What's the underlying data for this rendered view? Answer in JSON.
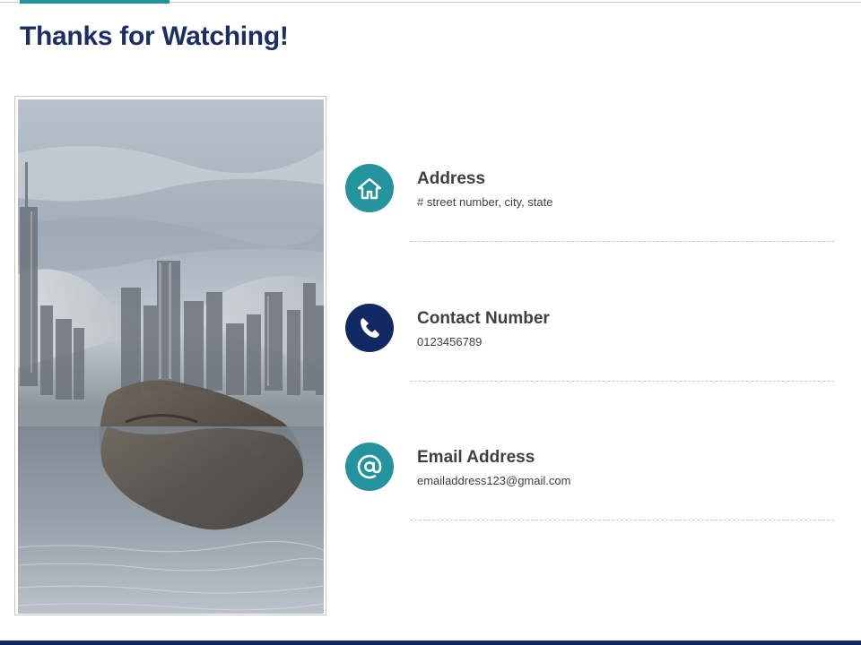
{
  "slide": {
    "title": "Thanks for Watching!"
  },
  "colors": {
    "title": "#1c2f63",
    "teal_accent": "#24939e",
    "navy_accent": "#122a63",
    "bottom_bar": "#122a63"
  },
  "photo": {
    "description_icon": "handshake-over-city-photo"
  },
  "contacts": [
    {
      "title": "Address",
      "detail": "# street number, city, state",
      "icon": "home-icon",
      "icon_color": "#24939e"
    },
    {
      "title": "Contact Number",
      "detail": "0123456789",
      "icon": "phone-icon",
      "icon_color": "#122a63"
    },
    {
      "title": "Email Address",
      "detail": "emailaddress123@gmail.com",
      "icon": "at-sign-icon",
      "icon_color": "#24939e"
    }
  ]
}
